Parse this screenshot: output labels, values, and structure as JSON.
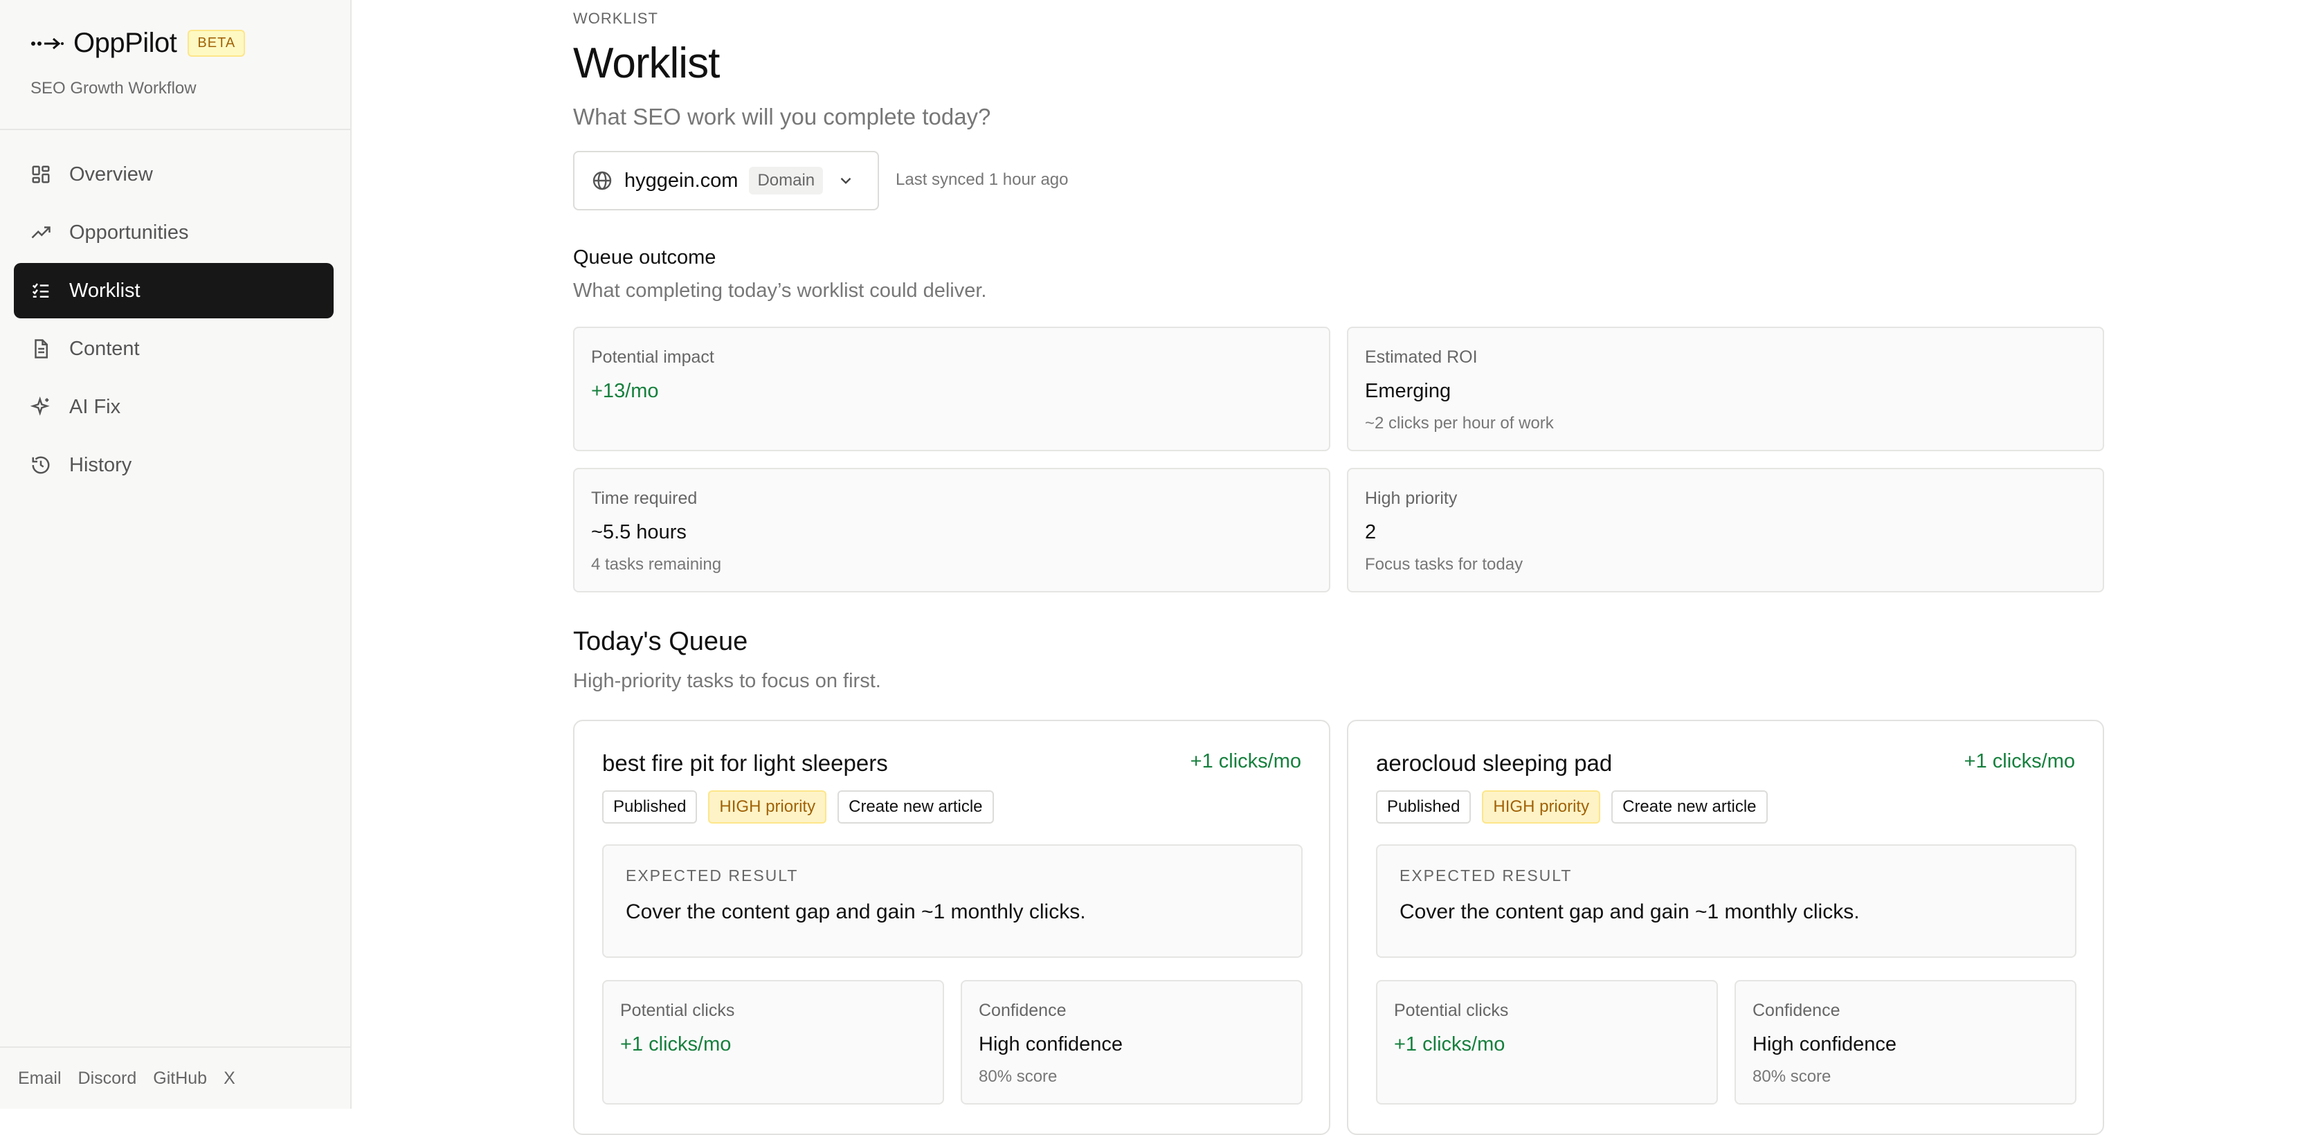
{
  "sidebar": {
    "brand": {
      "name": "OppPilot",
      "badge": "BETA",
      "subtitle": "SEO Growth Workflow"
    },
    "nav": [
      {
        "label": "Overview",
        "icon": "grid-icon",
        "active": false
      },
      {
        "label": "Opportunities",
        "icon": "trending-up-icon",
        "active": false
      },
      {
        "label": "Worklist",
        "icon": "list-checks-icon",
        "active": true
      },
      {
        "label": "Content",
        "icon": "document-icon",
        "active": false
      },
      {
        "label": "AI Fix",
        "icon": "sparkles-icon",
        "active": false
      },
      {
        "label": "History",
        "icon": "history-icon",
        "active": false
      }
    ],
    "footer_links": [
      "Email",
      "Discord",
      "GitHub",
      "X"
    ]
  },
  "header": {
    "eyebrow": "WORKLIST",
    "title": "Worklist",
    "subtitle": "What SEO work will you complete today?"
  },
  "domain_selector": {
    "domain": "hyggein.com",
    "badge": "Domain",
    "sync_status": "Last synced 1 hour ago"
  },
  "queue_outcome": {
    "title": "Queue outcome",
    "subtitle": "What completing today’s worklist could deliver.",
    "cards": [
      {
        "label": "Potential impact",
        "value": "+13/mo",
        "note": ""
      },
      {
        "label": "Estimated ROI",
        "value": "Emerging",
        "note": "~2 clicks per hour of work"
      },
      {
        "label": "Time required",
        "value": "~5.5 hours",
        "note": "4 tasks remaining"
      },
      {
        "label": "High priority",
        "value": "2",
        "note": "Focus tasks for today"
      }
    ]
  },
  "todays_queue": {
    "title": "Today's Queue",
    "subtitle": "High-priority tasks to focus on first.",
    "tasks": [
      {
        "title": "best fire pit for light sleepers",
        "clicks": "+1 clicks/mo",
        "status": "Published",
        "priority": "HIGH priority",
        "action": "Create new article",
        "expected_label": "EXPECTED RESULT",
        "expected_text": "Cover the content gap and gain ~1 monthly clicks.",
        "potential_label": "Potential clicks",
        "potential_value": "+1 clicks/mo",
        "confidence_label": "Confidence",
        "confidence_value": "High confidence",
        "confidence_score": "80% score"
      },
      {
        "title": "aerocloud sleeping pad",
        "clicks": "+1 clicks/mo",
        "status": "Published",
        "priority": "HIGH priority",
        "action": "Create new article",
        "expected_label": "EXPECTED RESULT",
        "expected_text": "Cover the content gap and gain ~1 monthly clicks.",
        "potential_label": "Potential clicks",
        "potential_value": "+1 clicks/mo",
        "confidence_label": "Confidence",
        "confidence_value": "High confidence",
        "confidence_score": "80% score"
      }
    ]
  },
  "colors": {
    "accent_green": "#15803d",
    "active_nav": "#171717",
    "priority_bg": "#fef3c7",
    "priority_text": "#a16207"
  }
}
